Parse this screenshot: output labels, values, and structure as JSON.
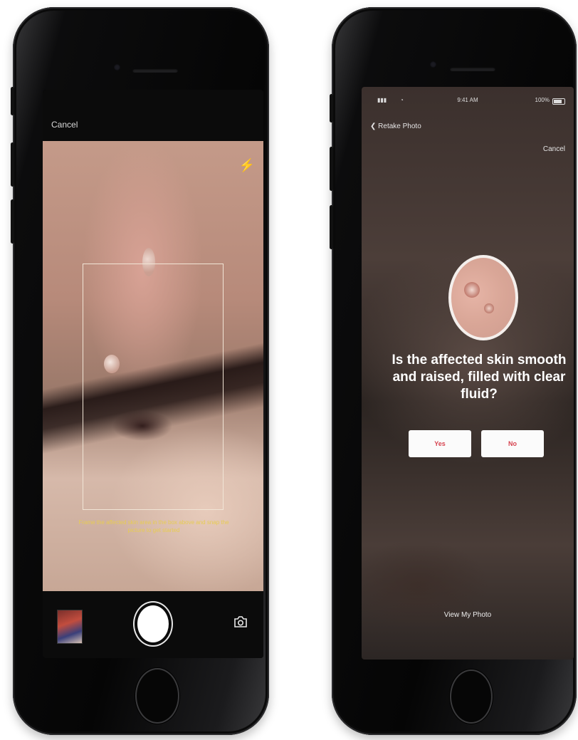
{
  "camera_screen": {
    "cancel_label": "Cancel",
    "instruction": "Frame the affected skin area in the box above and snap the picture to get started",
    "icons": {
      "flash": "flash-icon",
      "gallery": "photo-thumbnail",
      "shutter": "shutter-button",
      "flip": "camera-flip-icon"
    },
    "accent_color": "#e7cc52"
  },
  "question_screen": {
    "status_bar": {
      "time": "9:41 AM",
      "battery": "100%"
    },
    "back_label": "Retake Photo",
    "cancel_label": "Cancel",
    "question": "Is the affected skin smooth and raised, filled with clear fluid?",
    "yes_label": "Yes",
    "no_label": "No",
    "view_photos_label": "View My Photo",
    "accent_color": "#d6434f"
  }
}
